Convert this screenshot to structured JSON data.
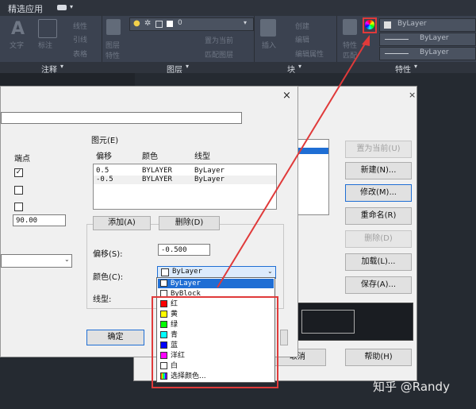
{
  "ribbon": {
    "tab_featured": "精选应用",
    "panel_annotate": "注释",
    "panel_layer": "图层",
    "panel_block": "块",
    "panel_properties": "特性",
    "ribbon_text_label": "文字",
    "ribbon_dim_label": "标注",
    "ribbon_linear": "线性",
    "ribbon_leader": "引线",
    "ribbon_table": "表格",
    "layer_properties": "图层",
    "layer_properties2": "特性",
    "layer_value": "0",
    "set_current": "置为当前",
    "match_layer": "匹配图层",
    "insert": "插入",
    "create": "创建",
    "edit": "编辑",
    "edit_attr": "编辑属性",
    "match_label": "特性",
    "match_label2": "匹配",
    "prop_color": "ByLayer",
    "prop_linetype": "ByLayer",
    "prop_lineweight": "ByLayer"
  },
  "back_dialog": {
    "set_current": "置为当前(U)",
    "new": "新建(N)...",
    "modify": "修改(M)...",
    "rename": "重命名(R)",
    "delete": "删除(D)",
    "load": "加载(L)...",
    "save": "保存(A)...",
    "cancel": "取消",
    "help": "帮助(H)"
  },
  "dialog": {
    "close": "×",
    "endpoints_label": "端点",
    "angle_value": "90.00",
    "elements_group": "图元(E)",
    "col_offset": "偏移",
    "col_color": "颜色",
    "col_linetype": "线型",
    "rows": [
      {
        "offset": "0.5",
        "color": "BYLAYER",
        "linetype": "ByLayer"
      },
      {
        "offset": "-0.5",
        "color": "BYLAYER",
        "linetype": "ByLayer"
      }
    ],
    "add_button": "添加(A)",
    "delete_button": "删除(D)",
    "offset_label": "偏移(S):",
    "offset_value": "-0.500",
    "color_label": "颜色(C):",
    "color_value": "ByLayer",
    "linetype_label": "线型:",
    "ok_button": "确定"
  },
  "color_dropdown": {
    "items": [
      {
        "label": "ByLayer",
        "swatch": "#ffffff",
        "selected": true
      },
      {
        "label": "ByBlock",
        "swatch": "#ffffff"
      },
      {
        "label": "红",
        "swatch": "#ff0000"
      },
      {
        "label": "黄",
        "swatch": "#ffff00"
      },
      {
        "label": "绿",
        "swatch": "#00ff00"
      },
      {
        "label": "青",
        "swatch": "#00ffff"
      },
      {
        "label": "蓝",
        "swatch": "#0000ff"
      },
      {
        "label": "洋红",
        "swatch": "#ff00ff"
      },
      {
        "label": "白",
        "swatch": "#ffffff"
      },
      {
        "label": "选择颜色...",
        "swatch": "multi"
      }
    ]
  },
  "watermark": "知乎 @Randy",
  "colors": {
    "annotation_red": "#e03a3a",
    "selection_blue": "#1f6ed4"
  }
}
